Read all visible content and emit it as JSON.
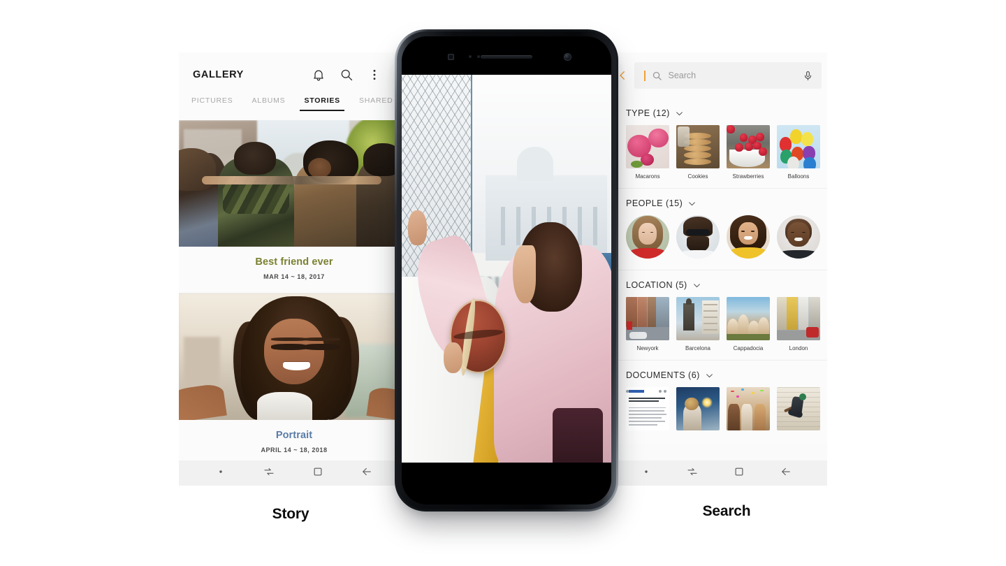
{
  "left_phone": {
    "caption": "Story",
    "app_title": "GALLERY",
    "header_icons": [
      {
        "name": "notification-bell-icon",
        "label": "Notifications"
      },
      {
        "name": "search-icon",
        "label": "Search"
      },
      {
        "name": "more-options-icon",
        "label": "More options"
      }
    ],
    "tabs": [
      {
        "label": "PICTURES",
        "active": false
      },
      {
        "label": "ALBUMS",
        "active": false
      },
      {
        "label": "STORIES",
        "active": true
      },
      {
        "label": "SHARED",
        "active": false
      }
    ],
    "stories": [
      {
        "title": "Best friend ever",
        "date": "MAR 14 ~ 18, 2017",
        "title_color": "#7b8131",
        "photo": "friends-group-street-photo"
      },
      {
        "title": "Portrait",
        "date": "APRIL 14 ~ 18, 2018",
        "title_color": "#5a7ca8",
        "photo": "smiling-woman-selfie-photo"
      }
    ],
    "nav": [
      {
        "name": "nav-dot-icon",
        "label": "Recent apps dot"
      },
      {
        "name": "nav-recents-icon",
        "label": "Recents"
      },
      {
        "name": "nav-home-icon",
        "label": "Home"
      },
      {
        "name": "nav-back-icon",
        "label": "Back"
      }
    ]
  },
  "center_phone": {
    "photo": "woman-pink-sweater-basketball-fence-photo",
    "hardware": [
      {
        "name": "proximity-sensor-icon"
      },
      {
        "name": "indicator-dots-icon"
      },
      {
        "name": "earpiece-speaker-icon"
      },
      {
        "name": "front-camera-icon"
      }
    ]
  },
  "right_phone": {
    "caption": "Search",
    "search": {
      "placeholder": "Search",
      "value": "",
      "back_icon": "back-chevron-icon",
      "back_color": "#f0a030",
      "search_icon": "search-icon",
      "mic_icon": "microphone-icon"
    },
    "sections": [
      {
        "title": "TYPE (12)",
        "shape": "square",
        "items": [
          {
            "label": "Macarons",
            "art": "t-macarons"
          },
          {
            "label": "Cookies",
            "art": "t-cookies"
          },
          {
            "label": "Strawberries",
            "art": "t-straw"
          },
          {
            "label": "Balloons",
            "art": "t-balloons"
          }
        ]
      },
      {
        "title": "PEOPLE (15)",
        "shape": "circle",
        "items": [
          {
            "label": "",
            "art": "av-1"
          },
          {
            "label": "",
            "art": "av-2"
          },
          {
            "label": "",
            "art": "av-3"
          },
          {
            "label": "",
            "art": "av-4"
          }
        ]
      },
      {
        "title": "LOCATION (5)",
        "shape": "square",
        "items": [
          {
            "label": "Newyork",
            "art": "t-newyork"
          },
          {
            "label": "Barcelona",
            "art": "t-barcelona"
          },
          {
            "label": "Cappadocia",
            "art": "t-cappa"
          },
          {
            "label": "London",
            "art": "t-london"
          }
        ]
      },
      {
        "title": "DOCUMENTS (6)",
        "shape": "square",
        "items": [
          {
            "label": "",
            "art": "t-doc"
          },
          {
            "label": "",
            "art": "t-sparkler"
          },
          {
            "label": "",
            "art": "t-party"
          },
          {
            "label": "",
            "art": "t-skate"
          }
        ]
      }
    ],
    "nav": [
      {
        "name": "nav-dot-icon",
        "label": "Recent apps dot"
      },
      {
        "name": "nav-recents-icon",
        "label": "Recents"
      },
      {
        "name": "nav-home-icon",
        "label": "Home"
      },
      {
        "name": "nav-back-icon",
        "label": "Back"
      }
    ]
  }
}
